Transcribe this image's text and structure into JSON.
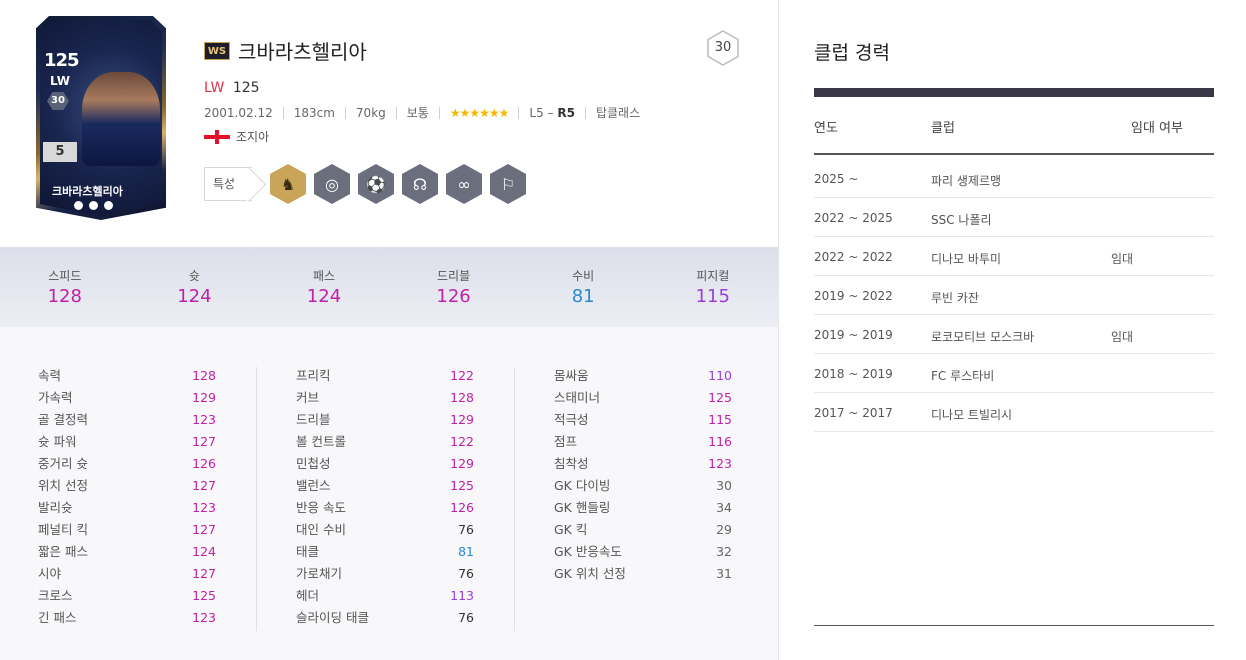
{
  "player": {
    "ws_badge": "WS",
    "name": "크바라츠헬리아",
    "position": "LW",
    "ovr": "125",
    "birthdate": "2001.02.12",
    "height": "183cm",
    "weight": "70kg",
    "body_type": "보통",
    "skill_stars": "★★★★★★",
    "foot_left": "L5",
    "foot_dash": " – ",
    "foot_right": "R5",
    "class": "탑클래스",
    "nation": "조지아",
    "level_badge": "30",
    "trait_label": "특성",
    "traits": [
      "trait-gold-icon",
      "trait-longshot-icon",
      "trait-dribble-icon",
      "trait-vision-icon",
      "trait-skill-icon",
      "trait-speed-icon"
    ]
  },
  "card": {
    "ovr": "125",
    "pos": "LW",
    "level": "30",
    "grade": "5",
    "name": "크바라츠헬리아"
  },
  "summary": [
    {
      "label": "스피드",
      "value": "128",
      "color": "#c21fa8"
    },
    {
      "label": "슛",
      "value": "124",
      "color": "#c21fa8"
    },
    {
      "label": "패스",
      "value": "124",
      "color": "#c21fa8"
    },
    {
      "label": "드리블",
      "value": "126",
      "color": "#c21fa8"
    },
    {
      "label": "수비",
      "value": "81",
      "color": "#2a8ad0"
    },
    {
      "label": "피지컬",
      "value": "115",
      "color": "#9a3ed6"
    }
  ],
  "stats_col1": [
    {
      "k": "속력",
      "v": "128",
      "color": "#c21fa8"
    },
    {
      "k": "가속력",
      "v": "129",
      "color": "#c21fa8"
    },
    {
      "k": "골 결정력",
      "v": "123",
      "color": "#c21fa8"
    },
    {
      "k": "슛 파워",
      "v": "127",
      "color": "#c21fa8"
    },
    {
      "k": "중거리 슛",
      "v": "126",
      "color": "#c21fa8"
    },
    {
      "k": "위치 선정",
      "v": "127",
      "color": "#c21fa8"
    },
    {
      "k": "발리슛",
      "v": "123",
      "color": "#c21fa8"
    },
    {
      "k": "페널티 킥",
      "v": "127",
      "color": "#c21fa8"
    },
    {
      "k": "짧은 패스",
      "v": "124",
      "color": "#c21fa8"
    },
    {
      "k": "시야",
      "v": "127",
      "color": "#c21fa8"
    },
    {
      "k": "크로스",
      "v": "125",
      "color": "#c21fa8"
    },
    {
      "k": "긴 패스",
      "v": "123",
      "color": "#c21fa8"
    }
  ],
  "stats_col2": [
    {
      "k": "프리킥",
      "v": "122",
      "color": "#c21fa8"
    },
    {
      "k": "커브",
      "v": "128",
      "color": "#c21fa8"
    },
    {
      "k": "드리블",
      "v": "129",
      "color": "#c21fa8"
    },
    {
      "k": "볼 컨트롤",
      "v": "122",
      "color": "#c21fa8"
    },
    {
      "k": "민첩성",
      "v": "129",
      "color": "#c21fa8"
    },
    {
      "k": "밸런스",
      "v": "125",
      "color": "#c21fa8"
    },
    {
      "k": "반응 속도",
      "v": "126",
      "color": "#c21fa8"
    },
    {
      "k": "대인 수비",
      "v": "76",
      "color": "#333333"
    },
    {
      "k": "태클",
      "v": "81",
      "color": "#2a8ad0"
    },
    {
      "k": "가로채기",
      "v": "76",
      "color": "#333333"
    },
    {
      "k": "헤더",
      "v": "113",
      "color": "#9a3ed6"
    },
    {
      "k": "슬라이딩 태클",
      "v": "76",
      "color": "#333333"
    }
  ],
  "stats_col3": [
    {
      "k": "몸싸움",
      "v": "110",
      "color": "#9a3ed6"
    },
    {
      "k": "스태미너",
      "v": "125",
      "color": "#c21fa8"
    },
    {
      "k": "적극성",
      "v": "115",
      "color": "#c21fa8"
    },
    {
      "k": "점프",
      "v": "116",
      "color": "#c21fa8"
    },
    {
      "k": "침착성",
      "v": "123",
      "color": "#c21fa8"
    },
    {
      "k": "GK 다이빙",
      "v": "30",
      "color": "#666666"
    },
    {
      "k": "GK 핸들링",
      "v": "34",
      "color": "#666666"
    },
    {
      "k": "GK 킥",
      "v": "29",
      "color": "#666666"
    },
    {
      "k": "GK 반응속도",
      "v": "32",
      "color": "#666666"
    },
    {
      "k": "GK 위치 선정",
      "v": "31",
      "color": "#666666"
    }
  ],
  "club_history": {
    "title": "클럽 경력",
    "headers": {
      "year": "연도",
      "club": "클럽",
      "loan": "임대 여부"
    },
    "rows": [
      {
        "year": "2025 ~",
        "club": "파리 생제르맹",
        "loan": ""
      },
      {
        "year": "2022 ~ 2025",
        "club": "SSC 나폴리",
        "loan": ""
      },
      {
        "year": "2022 ~ 2022",
        "club": "디나모 바투미",
        "loan": "임대"
      },
      {
        "year": "2019 ~ 2022",
        "club": "루빈 카잔",
        "loan": ""
      },
      {
        "year": "2019 ~ 2019",
        "club": "로코모티브 모스크바",
        "loan": "임대"
      },
      {
        "year": "2018 ~ 2019",
        "club": "FC 루스타비",
        "loan": ""
      },
      {
        "year": "2017 ~ 2017",
        "club": "디나모 트빌리시",
        "loan": ""
      }
    ]
  }
}
